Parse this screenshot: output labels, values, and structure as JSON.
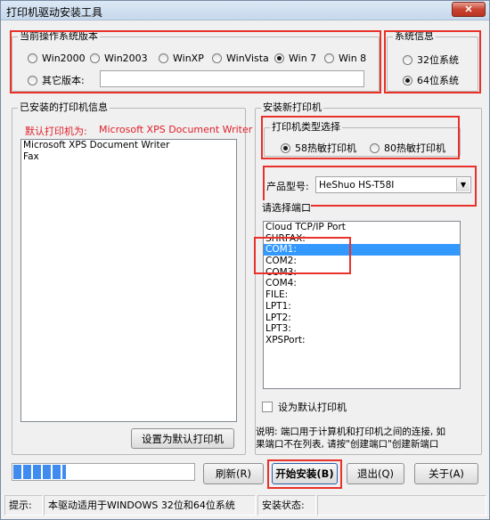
{
  "window": {
    "title": "打印机驱动安装工具",
    "close_label": "✕"
  },
  "os_group": {
    "title": "当前操作系统版本",
    "options": [
      "Win2000",
      "Win2003",
      "WinXP",
      "WinVista",
      "Win 7",
      "Win 8"
    ],
    "selected": "Win 7",
    "other_label": "其它版本:",
    "other_value": ""
  },
  "sys_group": {
    "title": "系统信息",
    "options": [
      "32位系统",
      "64位系统"
    ],
    "selected": "64位系统"
  },
  "installed_group": {
    "title": "已安装的打印机信息",
    "default_label": "默认打印机为:",
    "default_printer": "Microsoft XPS Document Writer",
    "printers": [
      "Microsoft XPS Document Writer",
      "Fax"
    ],
    "set_default_button": "设置为默认打印机"
  },
  "install_group": {
    "title": "安装新打印机",
    "type_group": {
      "title": "打印机类型选择",
      "options": [
        "58热敏打印机",
        "80热敏打印机"
      ],
      "selected": "58热敏打印机"
    },
    "model_label": "产品型号:",
    "model_value": "HeShuo HS-T58I",
    "port_title": "请选择端口",
    "ports": [
      "Cloud TCP/IP Port",
      "SHRFAX:",
      "COM1:",
      "COM2:",
      "COM3:",
      "COM4:",
      "FILE:",
      "LPT1:",
      "LPT2:",
      "LPT3:",
      "XPSPort:"
    ],
    "selected_port": "COM1:",
    "set_default_checkbox": "设为默认打印机",
    "note_line1": "说明: 端口用于计算机和打印机之间的连接, 如",
    "note_line2": "果端口不在列表, 请按\"创建端口\"创建新端口"
  },
  "progress": {
    "value": 0.3
  },
  "buttons": {
    "refresh": "刷新(R)",
    "start_install": "开始安装(B)",
    "exit": "退出(Q)",
    "about": "关于(A)"
  },
  "status": {
    "hint_label": "提示:",
    "hint_text": "本驱动适用于WINDOWS 32位和64位系统",
    "install_status_label": "安装状态:",
    "install_status_value": ""
  },
  "colors": {
    "annotation_red": "#e8312a",
    "selection_blue": "#3399ff"
  }
}
